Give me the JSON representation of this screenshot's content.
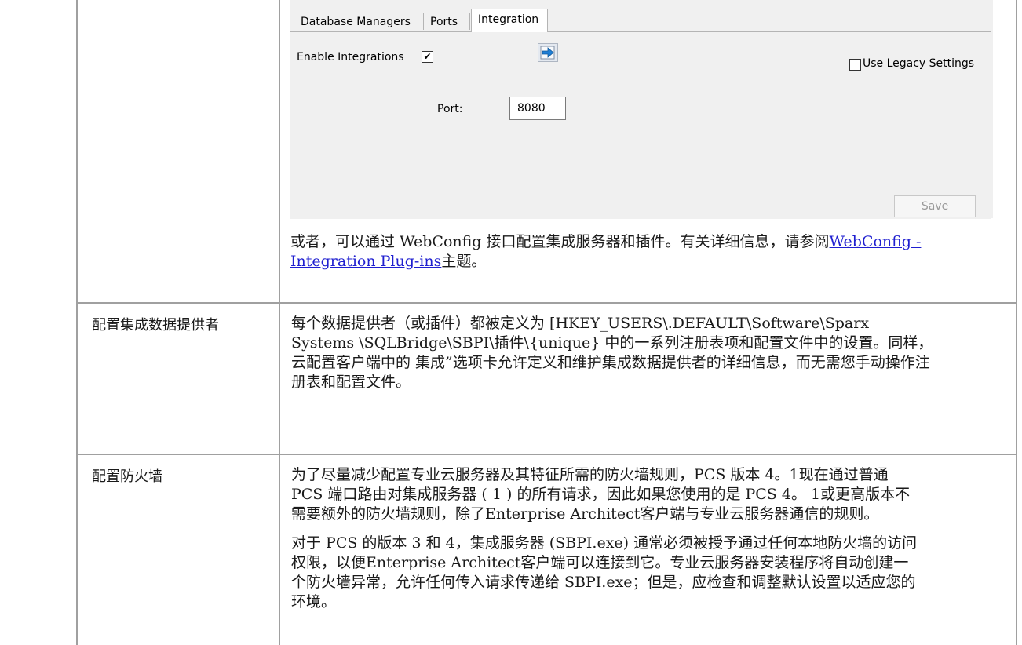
{
  "dialog": {
    "tabs": [
      "Database Managers",
      "Ports",
      "Integration"
    ],
    "active_tab": "Integration",
    "enable_integrations_label": "Enable Integrations",
    "enable_integrations_checked": true,
    "use_legacy_label": "Use Legacy Settings",
    "use_legacy_checked": false,
    "port_label": "Port:",
    "port_value": "8080",
    "save_label": "Save",
    "import_icon": "import-arrow-icon"
  },
  "webconfig_note": {
    "before": "或者，可以通过 WebConfig 接口配置集成服务器和插件。有关详细信息，请参阅",
    "link": "WebConfig - Integration Plug-ins",
    "after": "主题。"
  },
  "rows": [
    {
      "label": "配置集成数据提供者",
      "text": "每个数据提供者（或插件）都被定义为 [HKEY_USERS\\.DEFAULT\\Software\\Sparx Systems \\SQLBridge\\SBPI\\插件\\{unique} 中的一系列注册表项和配置文件中的设置。同样，云配置客户端中的 集成”选项卡允许定义和维护集成数据提供者的详细信息，而无需您手动操作注册表和配置文件。"
    },
    {
      "label": "配置防火墙",
      "para1": "为了尽量减少配置专业云服务器及其特征所需的防火墙规则，PCS 版本 4。1现在通过普通 PCS 端口路由对集成服务器 ( 1 ) 的所有请求，因此如果您使用的是 PCS 4。 1或更高版本不需要额外的防火墙规则，除了Enterprise Architect客户端与专业云服务器通信的规则。",
      "para2": "对于 PCS 的版本 3 和 4，集成服务器 (SBPI.exe) 通常必须被授予通过任何本地防火墙的访问权限，以便Enterprise Architect客户端可以连接到它。专业云服务器安装程序将自动创建一个防火墙异常，允许任何传入请求传递给 SBPI.exe；但是，应检查和调整默认设置以适应您的环境。"
    }
  ]
}
